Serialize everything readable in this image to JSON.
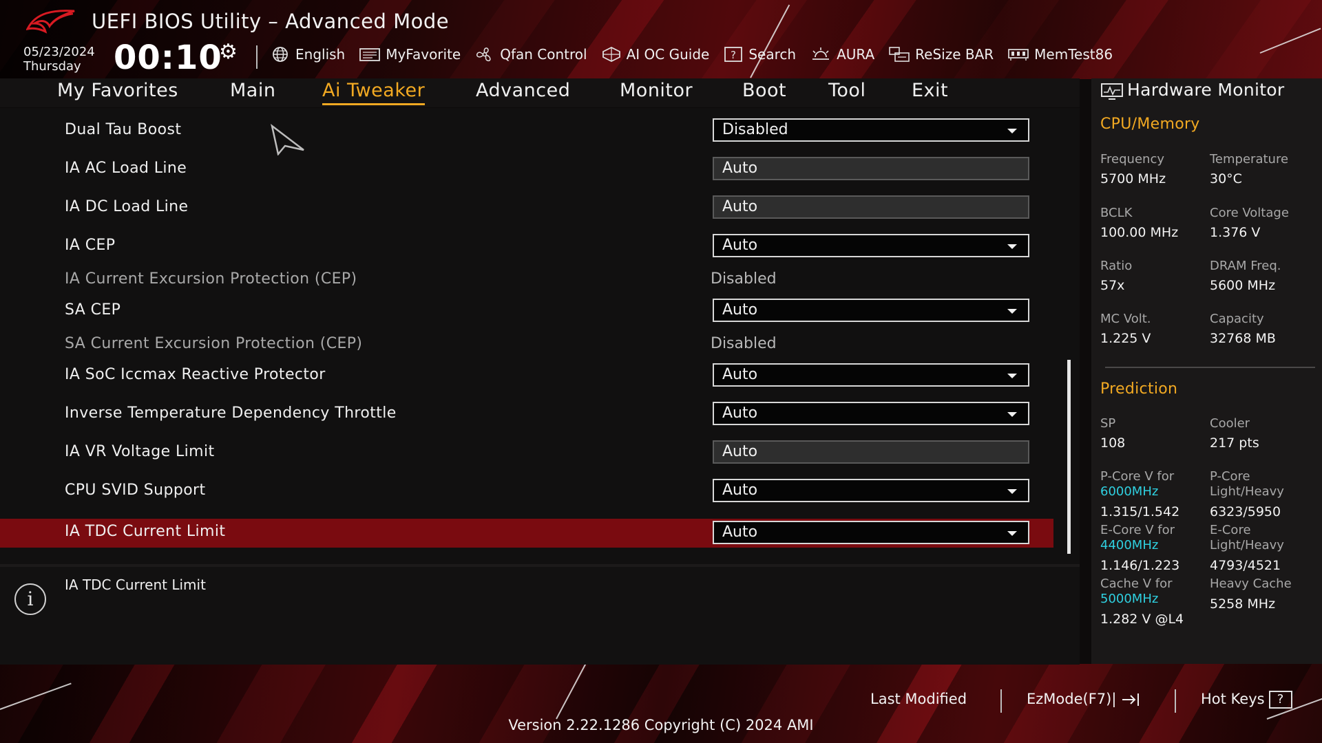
{
  "header": {
    "title": "UEFI BIOS Utility – Advanced Mode",
    "date": "05/23/2024",
    "day": "Thursday",
    "time": "00:10",
    "toolbar": [
      {
        "label": "English",
        "icon": "globe-icon"
      },
      {
        "label": "MyFavorite",
        "icon": "favorite-icon"
      },
      {
        "label": "Qfan Control",
        "icon": "fan-icon"
      },
      {
        "label": "AI OC Guide",
        "icon": "ai-oc-icon"
      },
      {
        "label": "Search",
        "icon": "search-icon"
      },
      {
        "label": "AURA",
        "icon": "aura-icon"
      },
      {
        "label": "ReSize BAR",
        "icon": "resize-bar-icon"
      },
      {
        "label": "MemTest86",
        "icon": "memtest-icon"
      }
    ]
  },
  "tabs": [
    {
      "label": "My Favorites",
      "active": false
    },
    {
      "label": "Main",
      "active": false
    },
    {
      "label": "Ai Tweaker",
      "active": true
    },
    {
      "label": "Advanced",
      "active": false
    },
    {
      "label": "Monitor",
      "active": false
    },
    {
      "label": "Boot",
      "active": false
    },
    {
      "label": "Tool",
      "active": false
    },
    {
      "label": "Exit",
      "active": false
    }
  ],
  "settings": [
    {
      "label": "Dual Tau Boost",
      "type": "select",
      "value": "Disabled"
    },
    {
      "label": "IA AC Load Line",
      "type": "field",
      "value": "Auto"
    },
    {
      "label": "IA DC Load Line",
      "type": "field",
      "value": "Auto"
    },
    {
      "label": "IA CEP",
      "type": "select",
      "value": "Auto"
    },
    {
      "label": "IA Current Excursion Protection (CEP)",
      "type": "readonly",
      "value": "Disabled"
    },
    {
      "label": "SA CEP",
      "type": "select",
      "value": "Auto"
    },
    {
      "label": "SA Current Excursion Protection (CEP)",
      "type": "readonly",
      "value": "Disabled"
    },
    {
      "label": "IA SoC Iccmax Reactive Protector",
      "type": "select",
      "value": "Auto"
    },
    {
      "label": "Inverse Temperature Dependency Throttle",
      "type": "select",
      "value": "Auto"
    },
    {
      "label": "IA VR Voltage Limit",
      "type": "field",
      "value": "Auto"
    },
    {
      "label": "CPU SVID Support",
      "type": "select",
      "value": "Auto"
    },
    {
      "label": "IA TDC Current Limit",
      "type": "select",
      "value": "Auto",
      "selected": true
    }
  ],
  "info": {
    "text": "IA TDC Current Limit"
  },
  "hardware_monitor": {
    "title": "Hardware Monitor",
    "cpu_memory": {
      "heading": "CPU/Memory",
      "frequency_label": "Frequency",
      "frequency": "5700 MHz",
      "temperature_label": "Temperature",
      "temperature": "30°C",
      "bclk_label": "BCLK",
      "bclk": "100.00 MHz",
      "core_voltage_label": "Core Voltage",
      "core_voltage": "1.376 V",
      "ratio_label": "Ratio",
      "ratio": "57x",
      "dram_freq_label": "DRAM Freq.",
      "dram_freq": "5600 MHz",
      "mc_volt_label": "MC Volt.",
      "mc_volt": "1.225 V",
      "capacity_label": "Capacity",
      "capacity": "32768 MB"
    },
    "prediction": {
      "heading": "Prediction",
      "sp_label": "SP",
      "sp": "108",
      "cooler_label": "Cooler",
      "cooler": "217 pts",
      "pcore_v_label": "P-Core V for",
      "pcore_v_freq": "6000MHz",
      "pcore_v": "1.315/1.542",
      "pcore_lh_label1": "P-Core",
      "pcore_lh_label2": "Light/Heavy",
      "pcore_lh": "6323/5950",
      "ecore_v_label": "E-Core V for",
      "ecore_v_freq": "4400MHz",
      "ecore_v": "1.146/1.223",
      "ecore_lh_label1": "E-Core",
      "ecore_lh_label2": "Light/Heavy",
      "ecore_lh": "4793/4521",
      "cache_v_label": "Cache V for",
      "cache_v_freq": "5000MHz",
      "cache_v": "1.282 V @L4",
      "heavy_cache_label": "Heavy Cache",
      "heavy_cache": "5258 MHz"
    }
  },
  "footer": {
    "last_modified": "Last Modified",
    "ezmode": "EzMode(F7)|",
    "hot_keys": "Hot Keys",
    "hot_keys_glyph": "?",
    "version": "Version 2.22.1286 Copyright (C) 2024 AMI"
  },
  "colors": {
    "accent": "#f2a922",
    "selected_row": "#7a0b10",
    "prediction_freq": "#2fd0e0"
  }
}
